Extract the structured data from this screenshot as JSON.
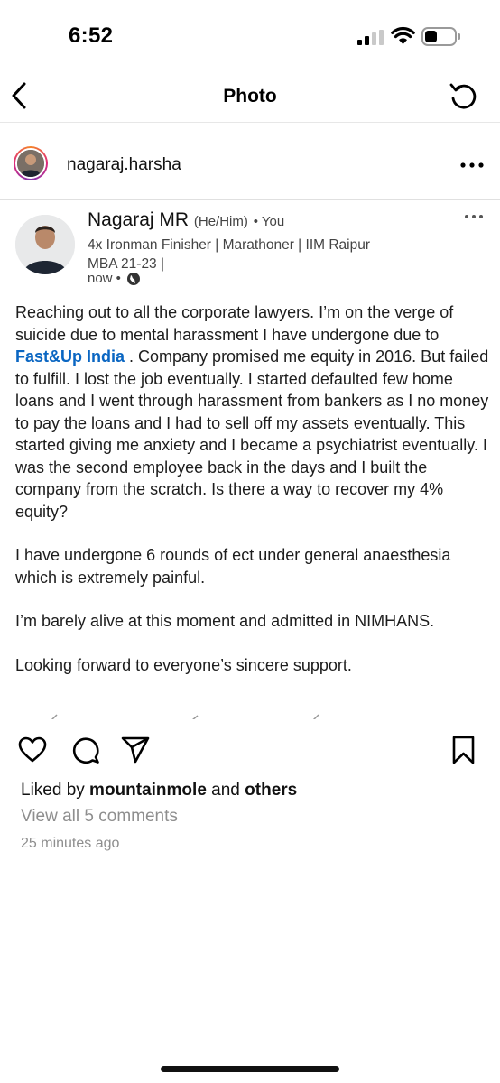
{
  "status_bar": {
    "time": "6:52"
  },
  "header": {
    "title": "Photo"
  },
  "post": {
    "username": "nagaraj.harsha",
    "linkedin": {
      "name": "Nagaraj MR",
      "pronouns": "(He/Him)",
      "relation": "• You",
      "headline_line1": "4x Ironman Finisher | Marathoner | IIM Raipur",
      "headline_line2": "MBA 21-23 |",
      "time": "now •",
      "body_part1": "Reaching out to all the corporate lawyers. I’m on the verge of suicide due to mental harassment I have undergone due to ",
      "body_link": "Fast&Up India",
      "body_part2": " . Company promised me equity in 2016. But failed to fulfill. I lost the job eventually. I started defaulted few home loans and I went through harassment from bankers as I no money to pay the loans and I had to sell off my assets eventually. This started giving me anxiety and I became a psychiatrist eventually. I was the second employee back in the days and I built the company from the scratch. Is there a way to recover my 4% equity?",
      "paragraph2": "I have undergone 6 rounds of ect under general anaesthesia which is extremely painful.",
      "paragraph3": "I’m barely alive at this moment and admitted in NIMHANS.",
      "paragraph4": "Looking forward to everyone’s sincere support."
    },
    "likes_prefix": "Liked by ",
    "likes_user": "mountainmole",
    "likes_mid": " and ",
    "likes_others": "others",
    "view_comments": "View all 5 comments",
    "time_ago": "25 minutes ago"
  },
  "colors": {
    "link": "#0a66c2",
    "muted": "#8e8e8e"
  },
  "icons": [
    "signal-icon",
    "wifi-icon",
    "battery-icon",
    "back-icon",
    "refresh-icon",
    "more-icon",
    "globe-icon",
    "heart-icon",
    "comment-icon",
    "share-icon",
    "bookmark-icon"
  ]
}
